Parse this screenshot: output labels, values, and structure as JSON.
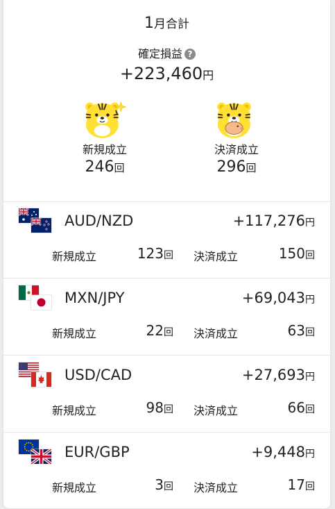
{
  "summary": {
    "month_number": "1",
    "month_label": "月合計",
    "profit_label": "確定損益",
    "help_icon": "?",
    "profit_value": "+223,460",
    "profit_unit": "円",
    "new_label": "新規成立",
    "new_value": "246",
    "close_label": "決済成立",
    "close_value": "296",
    "count_unit": "回"
  },
  "rows": [
    {
      "pair": "AUD/NZD",
      "pl": "+117,276",
      "pl_unit": "円",
      "new_label": "新規成立",
      "new": "123",
      "close_label": "決済成立",
      "close": "150",
      "unit": "回",
      "flags": [
        "au-flag",
        "nz-flag"
      ]
    },
    {
      "pair": "MXN/JPY",
      "pl": "+69,043",
      "pl_unit": "円",
      "new_label": "新規成立",
      "new": "22",
      "close_label": "決済成立",
      "close": "63",
      "unit": "回",
      "flags": [
        "mx-flag",
        "jp-flag"
      ]
    },
    {
      "pair": "USD/CAD",
      "pl": "+27,693",
      "pl_unit": "円",
      "new_label": "新規成立",
      "new": "98",
      "close_label": "決済成立",
      "close": "66",
      "unit": "回",
      "flags": [
        "us-flag",
        "ca-flag"
      ]
    },
    {
      "pair": "EUR/GBP",
      "pl": "+9,448",
      "pl_unit": "円",
      "new_label": "新規成立",
      "new": "3",
      "close_label": "決済成立",
      "close": "17",
      "unit": "回",
      "flags": [
        "eu-flag",
        "gb-flag"
      ]
    }
  ],
  "colors": {
    "mascot_yellow": "#ffe033",
    "mascot_stripe": "#3a2a1a",
    "separator": "#e6e6e6"
  }
}
